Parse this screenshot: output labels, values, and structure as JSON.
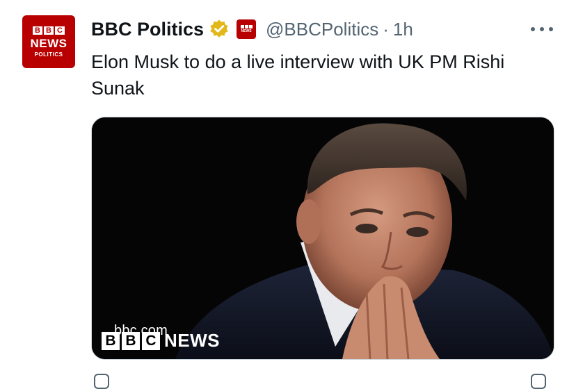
{
  "avatar": {
    "blocks": [
      "B",
      "B",
      "C"
    ],
    "line1": "NEWS",
    "line2": "POLITICS"
  },
  "header": {
    "name": "BBC Politics",
    "handle": "@BBCPolitics",
    "separator": "·",
    "time": "1h"
  },
  "tweet": {
    "text": "Elon Musk to do a live interview with UK PM Rishi Sunak"
  },
  "media": {
    "source_url": "bbc.com",
    "logo_blocks": [
      "B",
      "B",
      "C"
    ],
    "logo_word": "NEWS"
  },
  "icons": {
    "verified": "verified-gold-badge-icon",
    "affiliation": "bbc-news-affiliate-icon",
    "more": "more-options-icon"
  },
  "colors": {
    "bbc_red": "#b80000",
    "verified_gold": "#e2b719",
    "secondary_text": "#536471"
  }
}
